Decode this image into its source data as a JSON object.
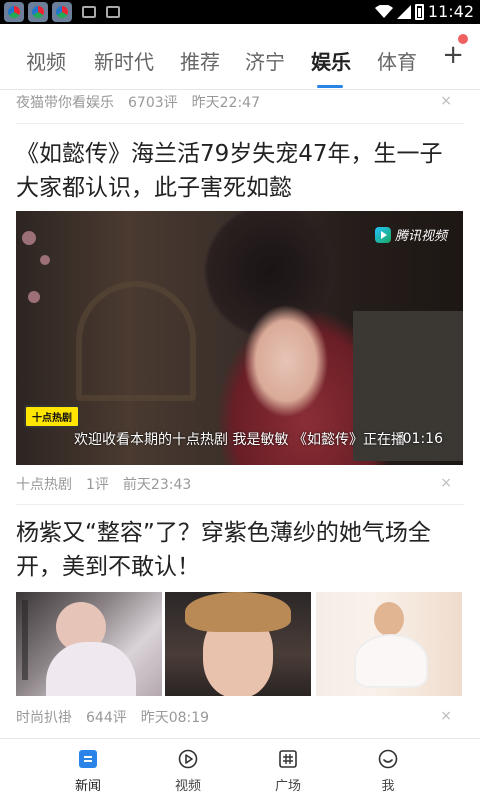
{
  "status_bar": {
    "time": "11:42"
  },
  "channels": {
    "tabs": [
      {
        "label": "视频"
      },
      {
        "label": "新时代"
      },
      {
        "label": "推荐"
      },
      {
        "label": "济宁"
      },
      {
        "label": "娱乐"
      },
      {
        "label": "体育"
      }
    ],
    "active": "娱乐",
    "add_label": "+"
  },
  "feed": {
    "top_item": {
      "source": "夜猫带你看娱乐",
      "comments": "6703评",
      "time": "昨天22:47"
    },
    "article1": {
      "title": "《如懿传》海兰活79岁失宠47年，生一子大家都认识，此子害死如懿",
      "video_logo": "腾讯视频",
      "video_stamp": "十点热剧",
      "video_subtitle": "欢迎收看本期的十点热剧 我是敏敏 《如懿传》正在播",
      "duration": "01:16",
      "source": "十点热剧",
      "comments": "1评",
      "time": "前天23:43"
    },
    "article2": {
      "title": "杨紫又“整容”了？穿紫色薄纱的她气场全开，美到不敢认！",
      "source": "时尚扒褂",
      "comments": "644评",
      "time": "昨天08:19"
    },
    "close_label": "×"
  },
  "bottom_nav": {
    "items": [
      {
        "label": "新闻",
        "icon": "news-icon"
      },
      {
        "label": "视频",
        "icon": "play-icon"
      },
      {
        "label": "广场",
        "icon": "square-icon"
      },
      {
        "label": "我",
        "icon": "smile-icon"
      }
    ],
    "accent": "#2a84e8"
  }
}
